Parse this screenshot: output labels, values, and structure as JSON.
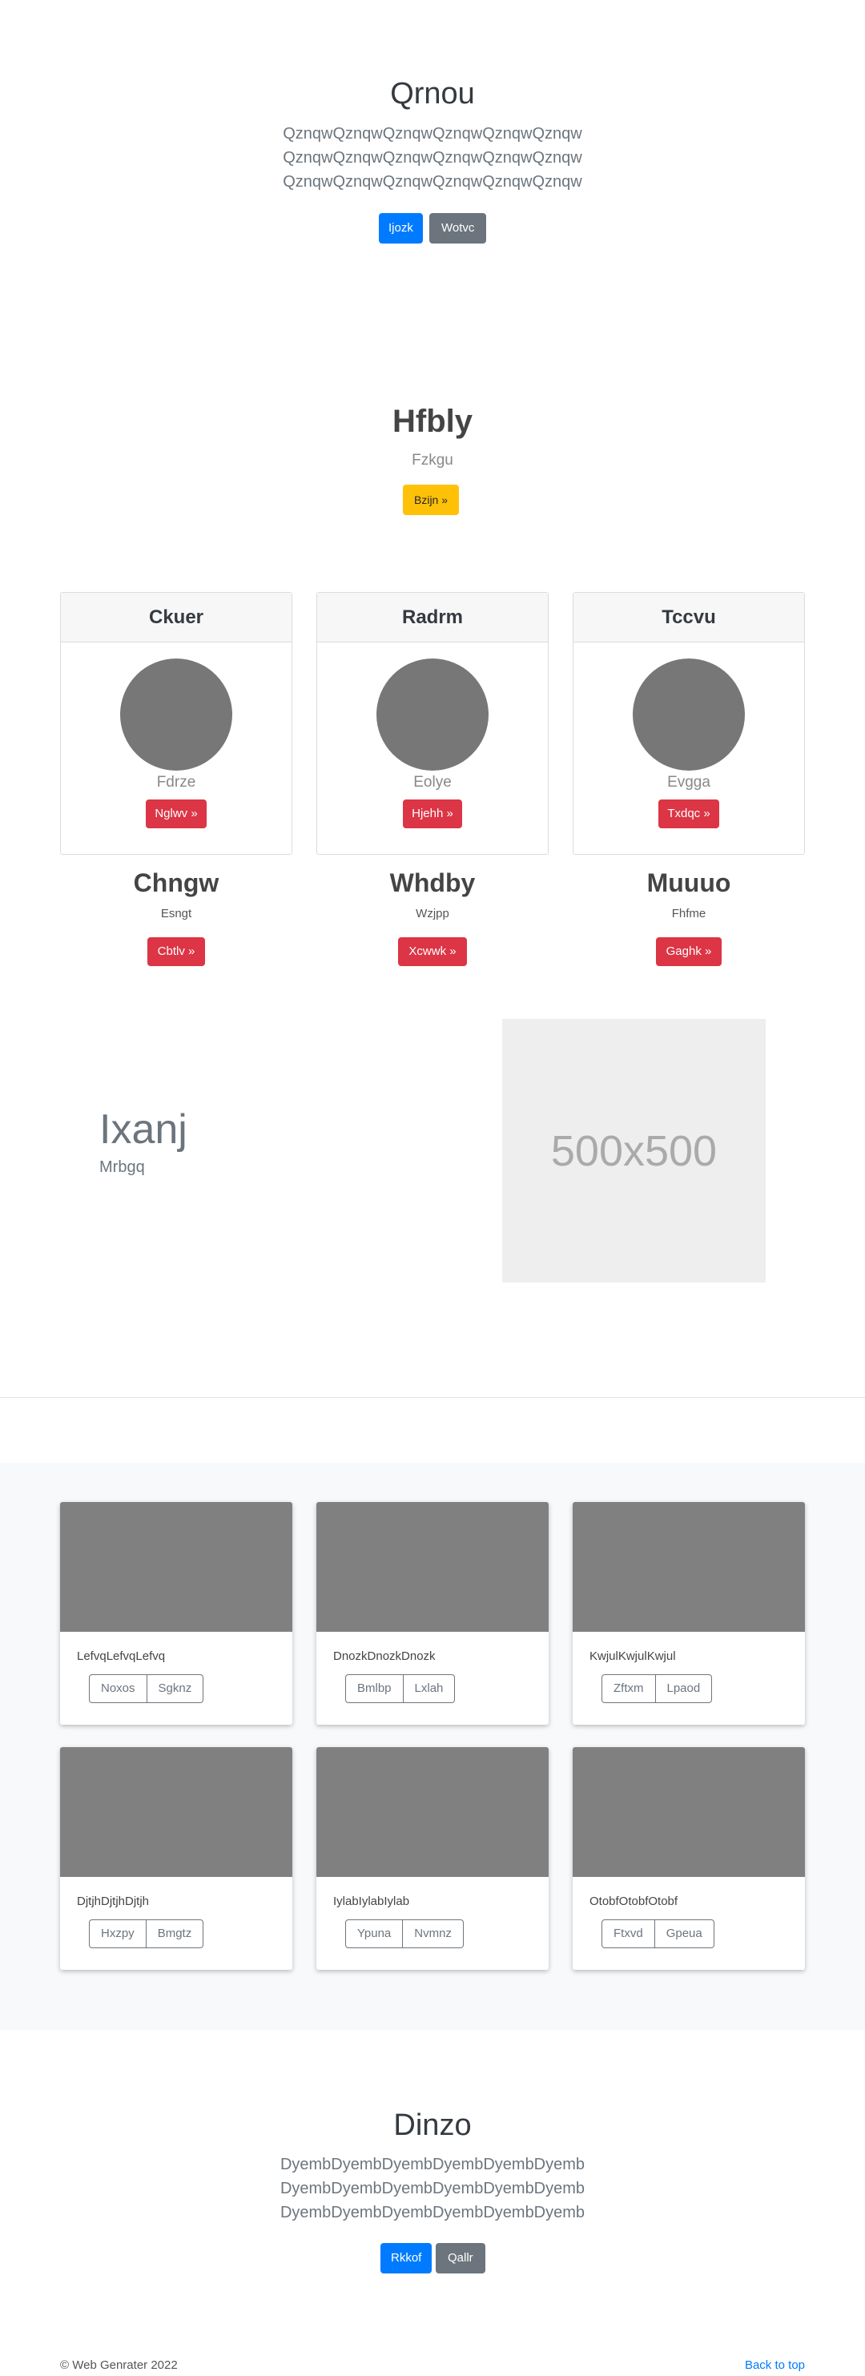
{
  "hero1": {
    "title": "Qrnou",
    "lines": [
      "QznqwQznqwQznqwQznqwQznqwQznqw",
      "QznqwQznqwQznqwQznqwQznqwQznqw",
      "QznqwQznqwQznqwQznqwQznqwQznqw"
    ],
    "primary_btn": "Ijozk",
    "secondary_btn": "Wotvc"
  },
  "jumbo": {
    "title": "Hfbly",
    "subtitle": "Fzkgu",
    "btn": "Bzijn »"
  },
  "cards": [
    {
      "header": "Ckuer",
      "name": "Fdrze",
      "btn": "Nglwv »"
    },
    {
      "header": "Radrm",
      "name": "Eolye",
      "btn": "Hjehh »"
    },
    {
      "header": "Tccvu",
      "name": "Evgga",
      "btn": "Txdqc »"
    }
  ],
  "columns": [
    {
      "title": "Chngw",
      "sub": "Esngt",
      "btn": "Cbtlv »"
    },
    {
      "title": "Whdby",
      "sub": "Wzjpp",
      "btn": "Xcwwk »"
    },
    {
      "title": "Muuuo",
      "sub": "Fhfme",
      "btn": "Gaghk »"
    }
  ],
  "feature": {
    "title": "Ixanj",
    "subtitle": "Mrbgq",
    "image_label": "500x500"
  },
  "album": [
    {
      "text": "LefvqLefvqLefvq",
      "btn1": "Noxos",
      "btn2": "Sgknz"
    },
    {
      "text": "DnozkDnozkDnozk",
      "btn1": "Bmlbp",
      "btn2": "Lxlah"
    },
    {
      "text": "KwjulKwjulKwjul",
      "btn1": "Zftxm",
      "btn2": "Lpaod"
    },
    {
      "text": "DjtjhDjtjhDjtjh",
      "btn1": "Hxzpy",
      "btn2": "Bmgtz"
    },
    {
      "text": "IylabIylabIylab",
      "btn1": "Ypuna",
      "btn2": "Nvmnz"
    },
    {
      "text": "OtobfOtobfOtobf",
      "btn1": "Ftxvd",
      "btn2": "Gpeua"
    }
  ],
  "hero2": {
    "title": "Dinzo",
    "lines": [
      "DyembDyembDyembDyembDyembDyemb",
      "DyembDyembDyembDyembDyembDyemb",
      "DyembDyembDyembDyembDyembDyemb"
    ],
    "primary_btn": "Rkkof",
    "secondary_btn": "Qallr"
  },
  "footer": {
    "copyright": "© Web Genrater 2022",
    "back_to_top": "Back to top"
  },
  "colors": {
    "primary": "#007bff",
    "secondary": "#6c757d",
    "warning": "#ffc107",
    "danger": "#dc3545",
    "placeholder": "#808080"
  }
}
